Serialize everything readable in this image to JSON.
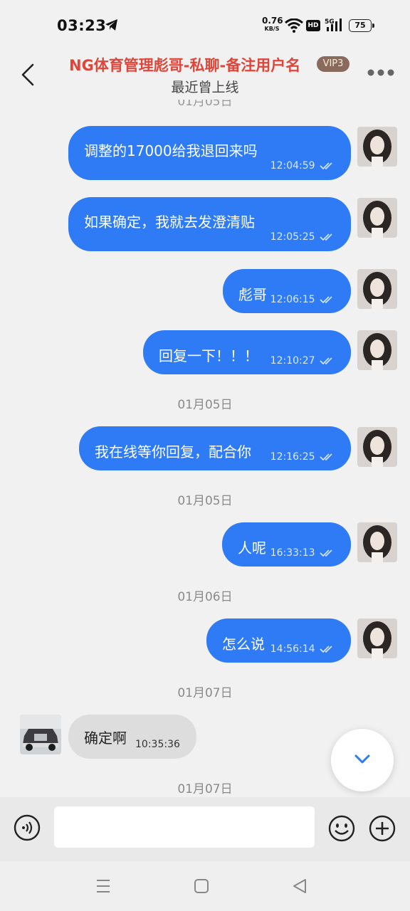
{
  "status_bar": {
    "time": "03:23",
    "net_speed_value": "0.76",
    "net_speed_unit": "KB/S",
    "hd_label": "HD",
    "battery": "75",
    "icons": [
      "telegram-icon",
      "wifi-icon",
      "5g-signal-icon",
      "battery-icon"
    ]
  },
  "header": {
    "title": "NG体育管理彪哥-私聊-备注用户名",
    "vip_badge": "VIP3",
    "subtitle": "最近曾上线"
  },
  "chat": {
    "clipped_date": "01月05日",
    "messages": [
      {
        "direction": "out",
        "text": "调整的17000给我退回来吗",
        "time": "12:04:59",
        "read": true
      },
      {
        "direction": "out",
        "text": "如果确定，我就去发澄清贴",
        "time": "12:05:25",
        "read": true
      },
      {
        "direction": "out",
        "text": "彪哥",
        "time": "12:06:15",
        "read": true
      },
      {
        "direction": "out",
        "text": "回复一下！！！",
        "time": "12:10:27",
        "read": true
      },
      {
        "direction": "date",
        "text": "01月05日"
      },
      {
        "direction": "out",
        "text": "我在线等你回复，配合你",
        "time": "12:16:25",
        "read": true
      },
      {
        "direction": "date",
        "text": "01月05日"
      },
      {
        "direction": "out",
        "text": "人呢",
        "time": "16:33:13",
        "read": true
      },
      {
        "direction": "date",
        "text": "01月06日"
      },
      {
        "direction": "out",
        "text": "怎么说",
        "time": "14:56:14",
        "read": true
      },
      {
        "direction": "date",
        "text": "01月07日"
      },
      {
        "direction": "in",
        "text": "确定啊",
        "time": "10:35:36"
      },
      {
        "direction": "date",
        "text": "01月07日"
      }
    ]
  },
  "input": {
    "placeholder": "",
    "value": ""
  },
  "colors": {
    "outgoing_bubble": "#2f7bf6",
    "incoming_bubble": "#dddddd",
    "title_red": "#e0453a",
    "vip_badge": "#8a6a5c"
  }
}
